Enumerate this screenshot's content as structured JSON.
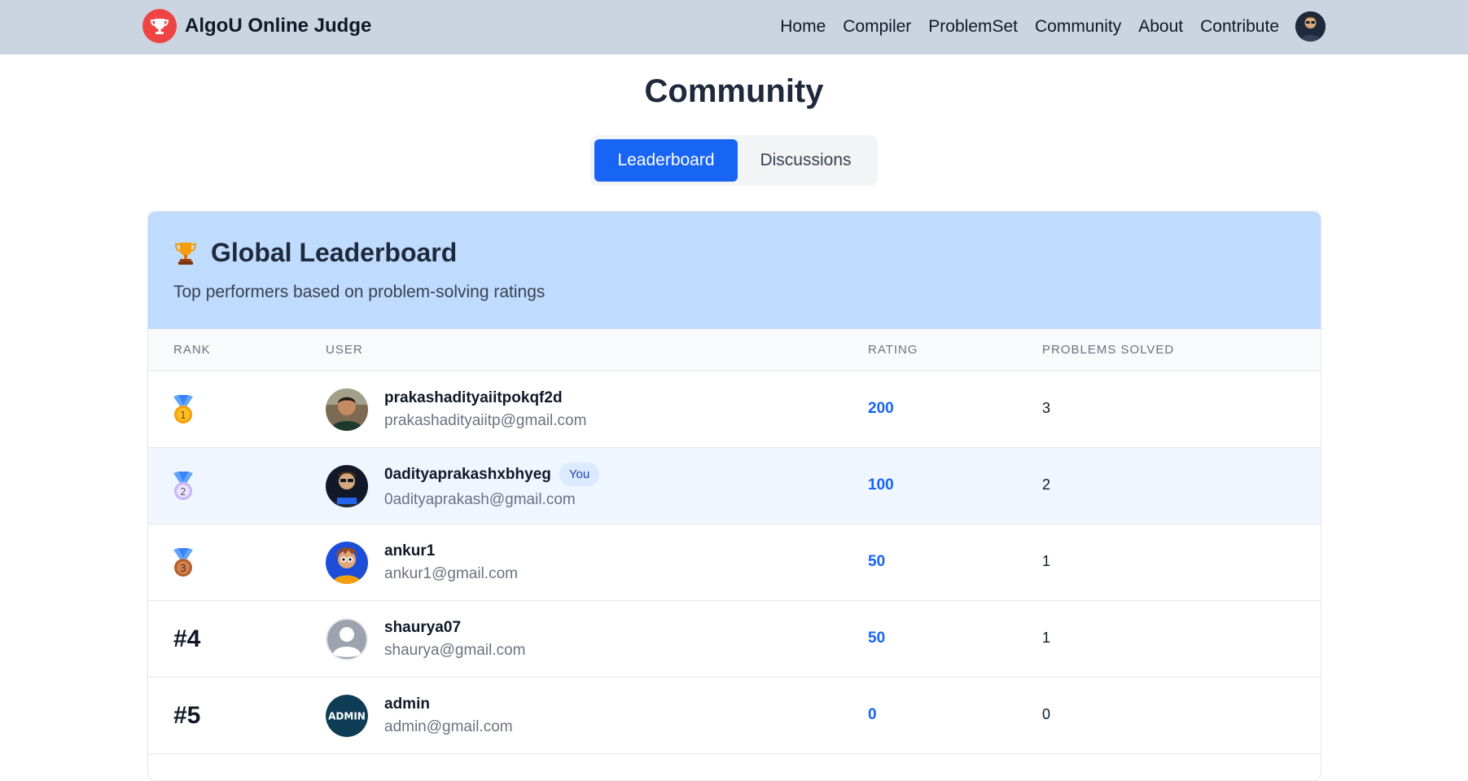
{
  "brand": {
    "name": "AlgoU Online Judge",
    "logo_icon": "trophy-icon",
    "color": "#ef4444"
  },
  "nav": {
    "links": [
      {
        "label": "Home"
      },
      {
        "label": "Compiler"
      },
      {
        "label": "ProblemSet"
      },
      {
        "label": "Community"
      },
      {
        "label": "About"
      },
      {
        "label": "Contribute"
      }
    ],
    "avatar_icon": "user-avatar-icon"
  },
  "page": {
    "title": "Community"
  },
  "tabs": [
    {
      "label": "Leaderboard",
      "active": true
    },
    {
      "label": "Discussions",
      "active": false
    }
  ],
  "leaderboard": {
    "title": "Global Leaderboard",
    "subtitle": "Top performers based on problem-solving ratings",
    "columns": {
      "rank": "RANK",
      "user": "USER",
      "rating": "RATING",
      "solved": "PROBLEMS SOLVED"
    },
    "rows": [
      {
        "rank": "1",
        "medal": "gold-medal-icon",
        "username": "prakashadityaiitpokqf2d",
        "email": "prakashadityaiitp@gmail.com",
        "rating": "200",
        "solved": "3",
        "you": false
      },
      {
        "rank": "2",
        "medal": "silver-medal-icon",
        "username": "0adityaprakashxbhyeg",
        "email": "0adityaprakash@gmail.com",
        "rating": "100",
        "solved": "2",
        "you": true,
        "you_label": "You"
      },
      {
        "rank": "3",
        "medal": "bronze-medal-icon",
        "username": "ankur1",
        "email": "ankur1@gmail.com",
        "rating": "50",
        "solved": "1",
        "you": false
      },
      {
        "rank": "#4",
        "username": "shaurya07",
        "email": "shaurya@gmail.com",
        "rating": "50",
        "solved": "1",
        "you": false
      },
      {
        "rank": "#5",
        "username": "admin",
        "email": "admin@gmail.com",
        "rating": "0",
        "solved": "0",
        "you": false,
        "avatar_text": "ADMIN"
      }
    ]
  },
  "colors": {
    "accent": "#1764f5",
    "navbar": "#cbd5e1",
    "header_bg": "#bfdbfe",
    "you_row": "#eff6ff"
  }
}
